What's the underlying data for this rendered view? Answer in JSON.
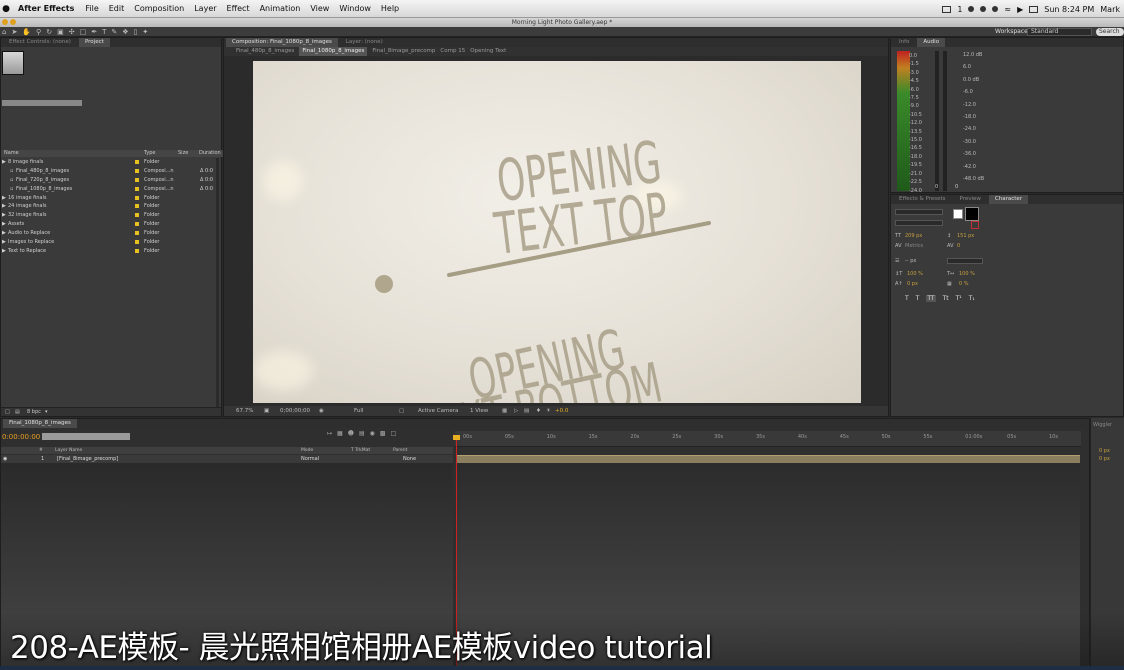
{
  "menubar": {
    "app_name": "After Effects",
    "items": [
      "File",
      "Edit",
      "Composition",
      "Layer",
      "Effect",
      "Animation",
      "View",
      "Window",
      "Help"
    ],
    "status_num": "1",
    "clock": "Sun 8:24 PM",
    "user": "Mark"
  },
  "window": {
    "title": "Morning Light Photo Gallery.aep *"
  },
  "toolbar": {
    "workspace_label": "Workspace:",
    "workspace_value": "Standard",
    "search_label": "Search"
  },
  "project_panel": {
    "tabs": [
      "Effect Controls: (none)",
      "Project"
    ],
    "columns": [
      "Name",
      "Type",
      "Size",
      "Duration"
    ],
    "items": [
      {
        "name": "8 image finals",
        "type": "Folder",
        "duration": "",
        "indent": 0
      },
      {
        "name": "Final_480p_8_images",
        "type": "Composi...n",
        "duration": "Δ 0:0",
        "indent": 1
      },
      {
        "name": "Final_720p_8_images",
        "type": "Composi...n",
        "duration": "Δ 0:0",
        "indent": 1
      },
      {
        "name": "Final_1080p_8_images",
        "type": "Composi...n",
        "duration": "Δ 0:0",
        "indent": 1
      },
      {
        "name": "16 image finals",
        "type": "Folder",
        "duration": "",
        "indent": 0
      },
      {
        "name": "24 image finals",
        "type": "Folder",
        "duration": "",
        "indent": 0
      },
      {
        "name": "32 image finals",
        "type": "Folder",
        "duration": "",
        "indent": 0
      },
      {
        "name": "Assets",
        "type": "Folder",
        "duration": "",
        "indent": 0
      },
      {
        "name": "Audio to Replace",
        "type": "Folder",
        "duration": "",
        "indent": 0
      },
      {
        "name": "Images to Replace",
        "type": "Folder",
        "duration": "",
        "indent": 0
      },
      {
        "name": "Text to Replace",
        "type": "Folder",
        "duration": "",
        "indent": 0
      }
    ],
    "footer_bpc": "8 bpc"
  },
  "composition_panel": {
    "tab_label": "Composition: Final_1080p_8_images",
    "layer_tab": "Layer: (none)",
    "breadcrumbs": [
      "Final_480p_8_images",
      "Final_1080p_8_images",
      "Final_8image_precomp",
      "Comp 15",
      "Opening Text"
    ],
    "active_breadcrumb": "Final_1080p_8_images",
    "viewer": {
      "top_text_line1": "OPENING",
      "top_text_line2": "TEXT TOP",
      "bottom_text_line1": "OPENING",
      "bottom_text_line2": "TEXT BOTTOM"
    },
    "controls": {
      "zoom": "67.7%",
      "timecode": "0;00;00;00",
      "resolution": "Full",
      "camera": "Active Camera",
      "views": "1 View",
      "exposure": "+0.0"
    }
  },
  "info_audio_panel": {
    "tabs": [
      "Info",
      "Audio"
    ],
    "db_left": [
      "0.0",
      "-1.5",
      "-3.0",
      "-4.5",
      "-6.0",
      "-7.5",
      "-9.0",
      "-10.5",
      "-12.0",
      "-13.5",
      "-15.0",
      "-16.5",
      "-18.0",
      "-19.5",
      "-21.0",
      "-22.5",
      "-24.0"
    ],
    "db_right": [
      "12.0 dB",
      "6.0",
      "0.0 dB",
      "-6.0",
      "-12.0",
      "-18.0",
      "-24.0",
      "-30.0",
      "-36.0",
      "-42.0",
      "-48.0 dB"
    ],
    "meter_bottom_labels": [
      "0",
      "0"
    ]
  },
  "character_panel": {
    "tabs": [
      "Effects & Presets",
      "Preview",
      "Character"
    ],
    "font_size": "209 px",
    "leading": "151 px",
    "kerning": "Metrics",
    "tracking": "0",
    "stroke_width": "-- px",
    "vert_scale": "100 %",
    "horiz_scale": "100 %",
    "baseline_shift": "0 px",
    "tsume": "0 %",
    "accent_color": "#c8a040"
  },
  "timeline": {
    "tab_label": "Final_1080p_8_images",
    "timecode": "0:00:00:00",
    "columns": [
      "#",
      "Layer Name",
      "Mode",
      "T TrkMat",
      "Parent"
    ],
    "layer": {
      "num": "1",
      "name": "[Final_8image_precomp]",
      "mode": "Normal",
      "parent": "None"
    },
    "ruler_ticks": [
      "00s",
      "05s",
      "10s",
      "15s",
      "20s",
      "25s",
      "30s",
      "35s",
      "40s",
      "45s",
      "50s",
      "55s",
      "01:00s",
      "05s",
      "10s"
    ],
    "playhead_color": "#d02020"
  },
  "right_strip": {
    "label": "Wiggler",
    "values": [
      "0 px",
      "0 px"
    ]
  },
  "caption": {
    "text": "208-AE模板- 晨光照相馆相册AE模板video tutorial"
  }
}
